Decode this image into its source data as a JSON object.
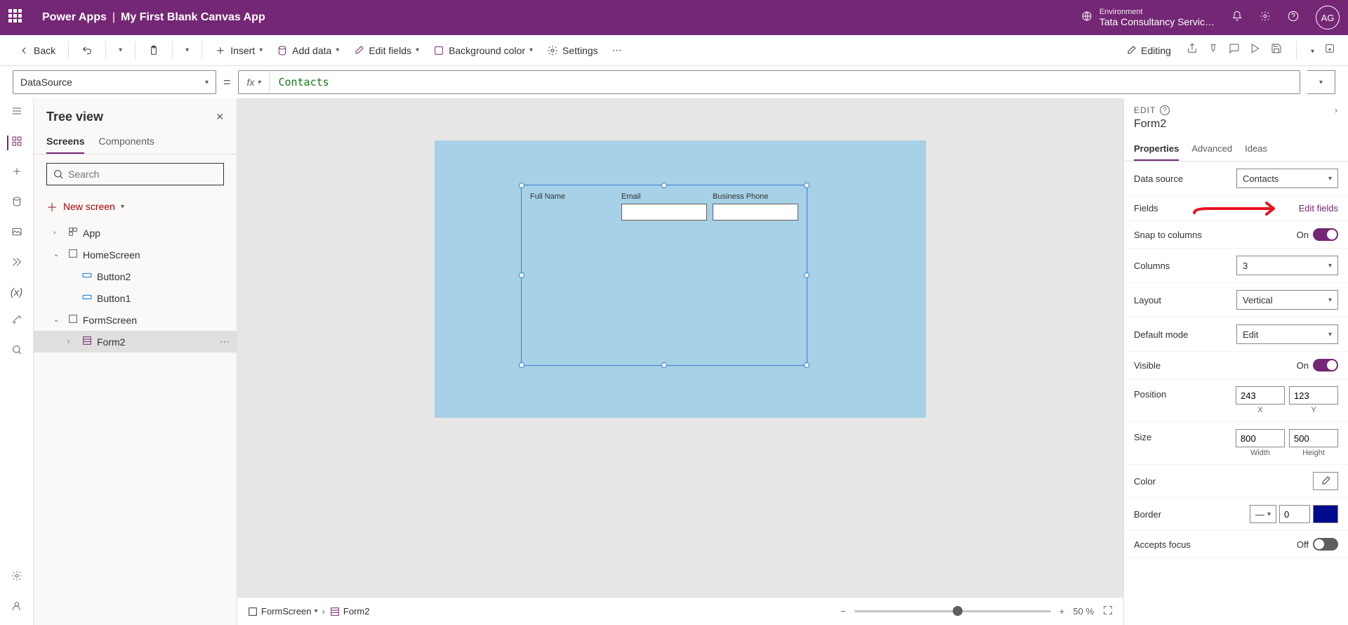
{
  "header": {
    "app_name": "Power Apps",
    "divider": "|",
    "file_name": "My First Blank Canvas App",
    "env_label": "Environment",
    "env_name": "Tata Consultancy Servic…",
    "avatar_initials": "AG"
  },
  "toolbar": {
    "back": "Back",
    "insert": "Insert",
    "add_data": "Add data",
    "edit_fields": "Edit fields",
    "background_color": "Background color",
    "settings": "Settings",
    "editing": "Editing"
  },
  "formula": {
    "property": "DataSource",
    "fx": "fx",
    "expression": "Contacts"
  },
  "tree": {
    "title": "Tree view",
    "tab_screens": "Screens",
    "tab_components": "Components",
    "search_placeholder": "Search",
    "new_screen": "New screen",
    "items": {
      "app": "App",
      "home": "HomeScreen",
      "button2": "Button2",
      "button1": "Button1",
      "formscreen": "FormScreen",
      "form2": "Form2"
    }
  },
  "canvas": {
    "fields": {
      "fullname": "Full Name",
      "email": "Email",
      "phone": "Business Phone"
    }
  },
  "breadcrumb": {
    "screen": "FormScreen",
    "form": "Form2"
  },
  "zoom": {
    "value": "50",
    "unit": "%"
  },
  "props": {
    "edit_label": "EDIT",
    "control_name": "Form2",
    "tab_properties": "Properties",
    "tab_advanced": "Advanced",
    "tab_ideas": "Ideas",
    "data_source_label": "Data source",
    "data_source_value": "Contacts",
    "fields_label": "Fields",
    "edit_fields_link": "Edit fields",
    "snap_label": "Snap to columns",
    "snap_on": "On",
    "columns_label": "Columns",
    "columns_value": "3",
    "layout_label": "Layout",
    "layout_value": "Vertical",
    "default_mode_label": "Default mode",
    "default_mode_value": "Edit",
    "visible_label": "Visible",
    "visible_on": "On",
    "position_label": "Position",
    "position_x": "243",
    "position_y": "123",
    "x_label": "X",
    "y_label": "Y",
    "size_label": "Size",
    "size_w": "800",
    "size_h": "500",
    "w_label": "Width",
    "h_label": "Height",
    "color_label": "Color",
    "border_label": "Border",
    "border_value": "0",
    "accepts_focus_label": "Accepts focus",
    "accepts_focus_off": "Off"
  }
}
